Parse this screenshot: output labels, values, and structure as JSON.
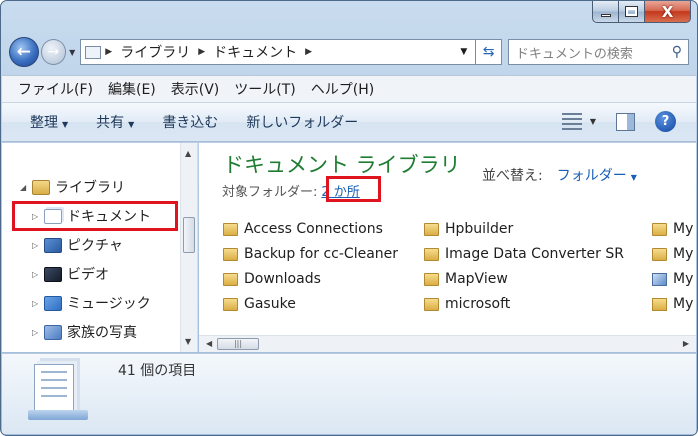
{
  "caption": {
    "minimize": "—",
    "maximize": "□",
    "close": "X"
  },
  "address": {
    "crumbs": [
      "ライブラリ",
      "ドキュメント"
    ],
    "search_placeholder": "ドキュメントの検索"
  },
  "menu": [
    "ファイル(F)",
    "編集(E)",
    "表示(V)",
    "ツール(T)",
    "ヘルプ(H)"
  ],
  "toolbar": {
    "organize": "整理",
    "share": "共有",
    "burn": "書き込む",
    "new_folder": "新しいフォルダー"
  },
  "nav": {
    "libraries": "ライブラリ",
    "items": [
      "ドキュメント",
      "ピクチャ",
      "ビデオ",
      "ミュージック",
      "家族の写真"
    ]
  },
  "library": {
    "title": "ドキュメント ライブラリ",
    "includes_label": "対象フォルダー:",
    "locations_link": "2 か所",
    "arrange_label": "並べ替え:",
    "arrange_value": "フォルダー"
  },
  "files": {
    "col1": [
      "Access Connections",
      "Backup for cc-Cleaner",
      "Downloads",
      "Gasuke"
    ],
    "col2": [
      "Hpbuilder",
      "Image Data Converter SR",
      "MapView",
      "microsoft"
    ],
    "col3": [
      "My",
      "My",
      "My",
      "My"
    ]
  },
  "details": {
    "count": "41 個の項目"
  },
  "colors": {
    "title_green": "#1f7d33",
    "link_blue": "#1a5fb4",
    "highlight_red": "#e0141e"
  }
}
